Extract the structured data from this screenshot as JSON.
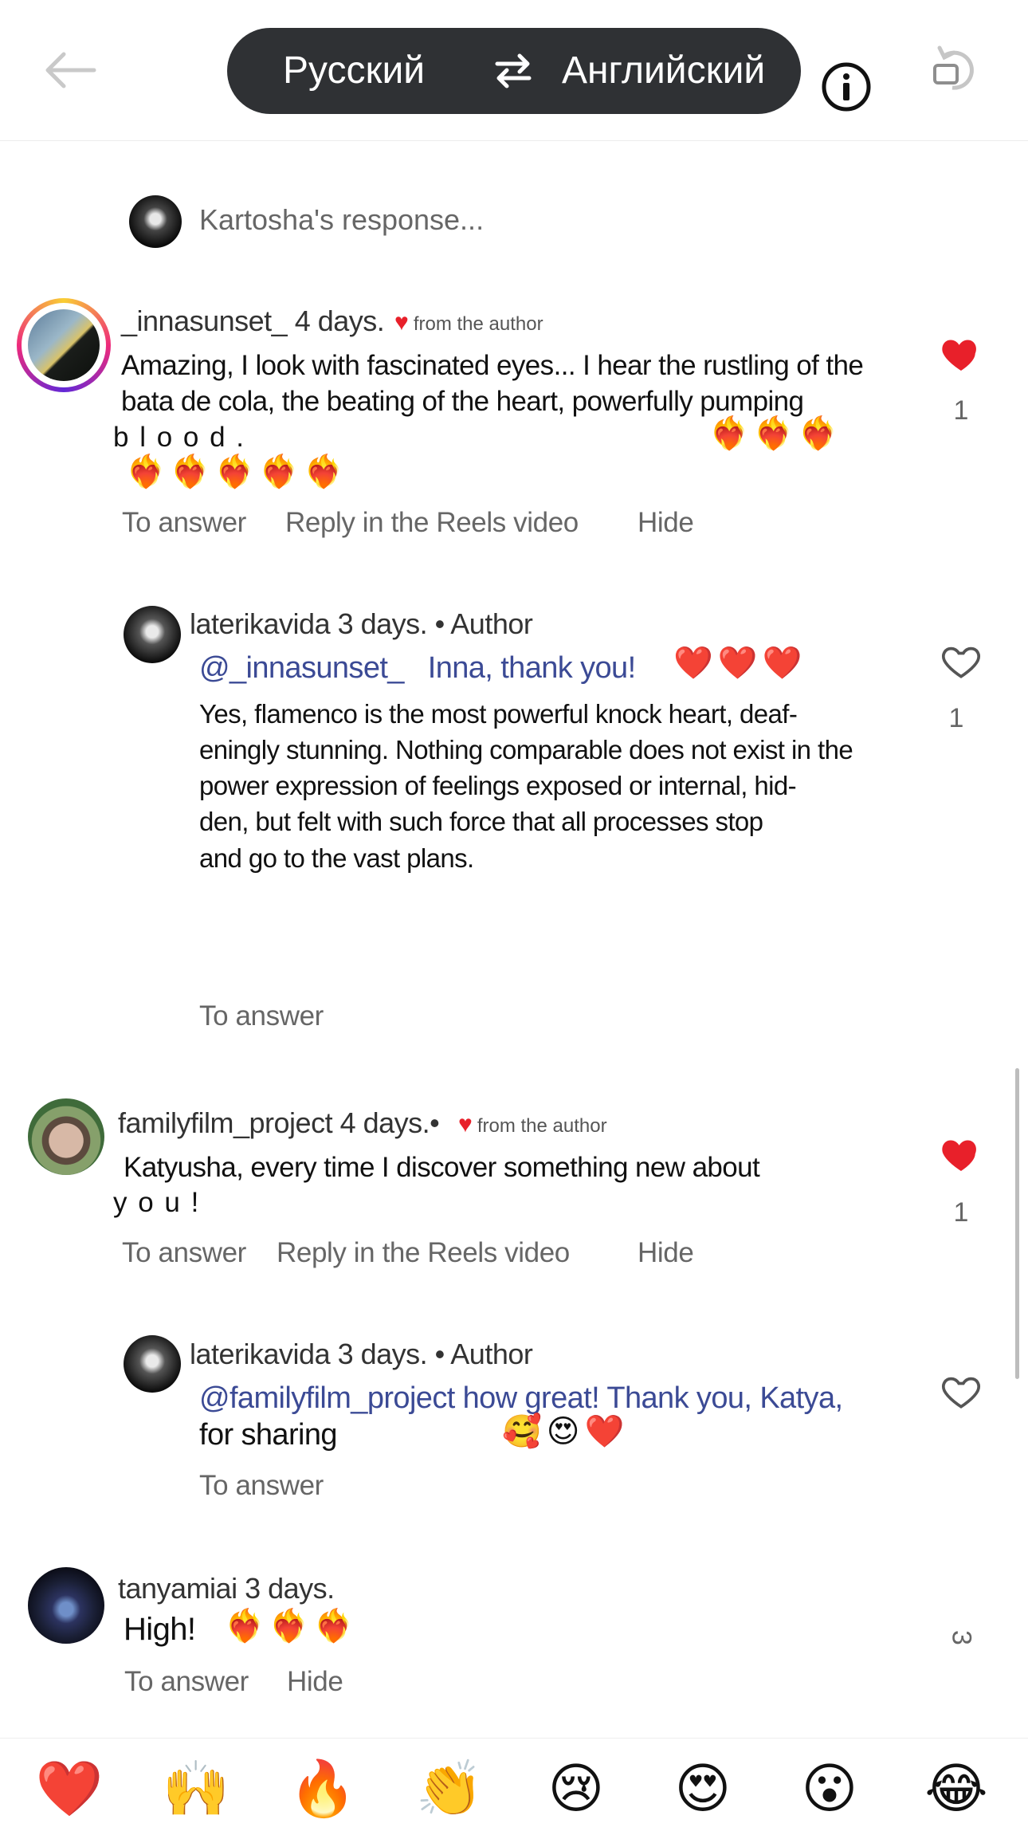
{
  "header": {
    "source_language": "Русский",
    "target_language": "Английский",
    "icons": [
      "back-arrow-icon",
      "swap-arrows-icon",
      "info-icon",
      "rotate-icon"
    ]
  },
  "response_bar": {
    "placeholder": "Kartosha's response..."
  },
  "comments": [
    {
      "username": "_innasunset_",
      "time": "4 days.",
      "author_badge": "from the author",
      "text_lines": [
        "Amazing, I look with fascinated eyes... I hear the rustling of the",
        "bata de cola, the beating of the heart, powerfully pumping",
        "b l o o d ."
      ],
      "emoji_inline": "❤️‍🔥❤️‍🔥❤️‍🔥",
      "emoji_line": "❤️‍🔥❤️‍🔥❤️‍🔥❤️‍🔥❤️‍🔥",
      "actions": [
        "To answer",
        "Reply in the Reels video",
        "Hide"
      ],
      "likes": "1",
      "liked": true
    },
    {
      "username": "laterikavida",
      "time": "3 days. • Author",
      "mention": "@_innasunset_",
      "headline": "Inna, thank you!",
      "headline_emoji": "❤️❤️❤️",
      "text_lines": [
        "Yes, flamenco is the most powerful knock heart, deaf-",
        "eningly stunning. Nothing comparable does not exist in the",
        "power expression of feelings exposed or internal, hid-",
        "den, but felt with such force that all processes stop",
        "and  go  to  the  vast  plans."
      ],
      "actions": [
        "To answer"
      ],
      "likes": "1",
      "liked": false
    },
    {
      "username": "familyfilm_project",
      "time": "4 days.•",
      "author_badge": "from the author",
      "text_lines": [
        "Katyusha, every time I discover something new about",
        "y o u !"
      ],
      "actions": [
        "To answer",
        "Reply in the Reels video",
        "Hide"
      ],
      "likes": "1",
      "liked": true
    },
    {
      "username": "laterikavida",
      "time": "3 days. • Author",
      "mention_text": "@familyfilm_project how great! Thank you, Katya,",
      "text_lines": [
        "for   sharing"
      ],
      "emoji_inline": "🥰😍❤️",
      "actions": [
        "To answer"
      ],
      "liked": false
    },
    {
      "username": "tanyamiai",
      "time": "3 days.",
      "text": "High!",
      "emoji_inline": "❤️‍🔥❤️‍🔥❤️‍🔥",
      "actions": [
        "To answer",
        "Hide"
      ],
      "likes": "3"
    }
  ],
  "reactions": [
    "❤️",
    "🙌",
    "🔥",
    "👏",
    "😢",
    "😍",
    "😮",
    "😂"
  ],
  "colors": {
    "like_red": "#e8202a",
    "mention_blue": "#3b4a95",
    "pill_dark": "#2f3134"
  }
}
